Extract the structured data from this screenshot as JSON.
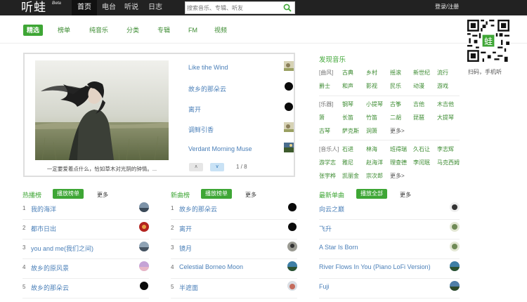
{
  "header": {
    "logo": "听蛙",
    "beta": "Beta",
    "nav": [
      "首页",
      "电台",
      "听说",
      "日志"
    ],
    "search_placeholder": "搜索音乐、专辑、听友",
    "login": "登录/注册"
  },
  "subnav": [
    "精选",
    "榜单",
    "纯音乐",
    "分类",
    "专辑",
    "FM",
    "视频"
  ],
  "qr": {
    "label": "扫码，手机听"
  },
  "banner": {
    "caption": "一定要爱着点什么，恰如草木对光阴的钟情。...",
    "songs": [
      "Like tihe Wind",
      "故乡的那朵云",
      "离开",
      "调鲜引香",
      "Verdant Morning Muse"
    ],
    "prev": "∧",
    "next": "∨",
    "page": "1 / 8"
  },
  "discover": {
    "title": "发现音乐",
    "groups": [
      {
        "cat": "[曲风]",
        "items": [
          "古典",
          "乡村",
          "摇滚",
          "新世纪",
          "流行"
        ]
      },
      {
        "cat": "",
        "items": [
          "爵士",
          "和声",
          "影视",
          "民乐",
          "动漫",
          "游戏"
        ]
      },
      {
        "cat": "[乐器]",
        "items": [
          "钢琴",
          "小提琴",
          "古筝",
          "吉他",
          "木吉他"
        ]
      },
      {
        "cat": "",
        "items": [
          "箫",
          "长笛",
          "竹笛",
          "二胡",
          "琵琶",
          "大提琴"
        ]
      },
      {
        "cat": "",
        "items": [
          "古琴",
          "萨克斯",
          "洞箫"
        ],
        "more": "更多>"
      },
      {
        "cat": "[音乐人]",
        "items": [
          "石进",
          "林海",
          "班得瑞",
          "久石让",
          "李志辉"
        ]
      },
      {
        "cat": "",
        "items": [
          "游学志",
          "雅尼",
          "赵海洋",
          "理查德",
          "李闰珉",
          "马克西姆"
        ]
      },
      {
        "cat": "",
        "items": [
          "张宇桦",
          "凯丽金",
          "宗次郎"
        ],
        "more": "更多>"
      }
    ]
  },
  "charts": [
    {
      "title": "热播榜",
      "play": "播放榜单",
      "more": "更多",
      "items": [
        "我的海洋",
        "都市日出",
        "you and me(我们之间)",
        "故乡的原风景",
        "故乡的那朵云"
      ]
    },
    {
      "title": "新曲榜",
      "play": "播放榜单",
      "more": "更多",
      "items": [
        "故乡的那朵云",
        "离开",
        "镜月",
        "Celestial Borneo Moon",
        "半遮面"
      ]
    },
    {
      "title": "最新单曲",
      "play": "播放全部",
      "more": "更多",
      "items": [
        "向云之巅",
        "飞升",
        "A Star Is Born",
        "River Flows In You (Piano LoFi Version)",
        "Fuji"
      ]
    }
  ],
  "ranks": [
    "1",
    "2",
    "3",
    "4",
    "5"
  ],
  "colors": {
    "accent": "#3ea635",
    "link": "#4a7fb8",
    "topbar": "#222222"
  }
}
